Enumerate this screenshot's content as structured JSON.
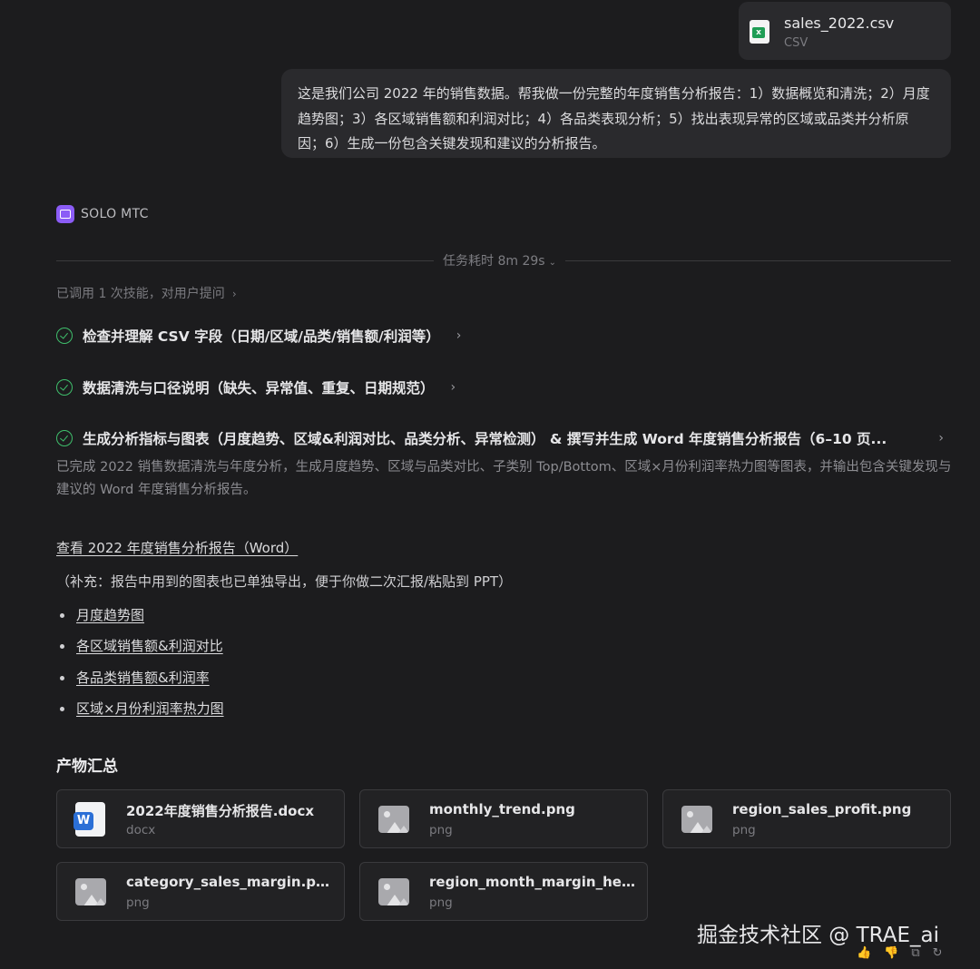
{
  "attachment": {
    "name": "sales_2022.csv",
    "type": "CSV",
    "icon": "excel-file-icon"
  },
  "user_message": "这是我们公司 2022 年的销售数据。帮我做一份完整的年度销售分析报告：1）数据概览和清洗；2）月度趋势图；3）各区域销售额和利润对比；4）各品类表现分析；5）找出表现异常的区域或品类并分析原因；6）生成一份包含关键发现和建议的分析报告。",
  "agent": {
    "name": "SOLO MTC",
    "icon": "agent-icon"
  },
  "task_time": "任务耗时 8m 29s",
  "skills_note": "已调用 1 次技能，对用户提问",
  "steps": [
    {
      "label": "检查并理解 CSV 字段（日期/区域/品类/销售额/利润等）"
    },
    {
      "label": "数据清洗与口径说明（缺失、异常值、重复、日期规范）"
    },
    {
      "label": "生成分析指标与图表（月度趋势、区域&利润对比、品类分析、异常检测） & 撰写并生成 Word 年度销售分析报告（6–10 页..."
    }
  ],
  "summary": "已完成 2022 销售数据清洗与年度分析，生成月度趋势、区域与品类对比、子类别 Top/Bottom、区域×月份利润率热力图等图表，并输出包含关键发现与建议的 Word 年度销售分析报告。",
  "report_link": "查看 2022 年度销售分析报告（Word）",
  "note": "（补充：报告中用到的图表也已单独导出，便于你做二次汇报/粘贴到 PPT）",
  "chart_links": [
    "月度趋势图",
    "各区域销售额&利润对比",
    "各品类销售额&利润率",
    "区域×月份利润率热力图"
  ],
  "artifacts_title": "产物汇总",
  "artifacts": [
    {
      "name": "2022年度销售分析报告.docx",
      "ext": "docx",
      "icon": "word-doc-icon"
    },
    {
      "name": "monthly_trend.png",
      "ext": "png",
      "icon": "image-file-icon"
    },
    {
      "name": "region_sales_profit.png",
      "ext": "png",
      "icon": "image-file-icon"
    },
    {
      "name": "category_sales_margin.png",
      "ext": "png",
      "icon": "image-file-icon"
    },
    {
      "name": "region_month_margin_heatmap.png",
      "ext": "png",
      "icon": "image-file-icon"
    }
  ],
  "watermark": "掘金技术社区 @ TRAE_ai",
  "colors": {
    "background": "#1c1c1e",
    "success": "#3fbf6c",
    "agent_accent": "#8b5cf6",
    "word_blue": "#2b6fd6",
    "excel_green": "#1f9d55"
  }
}
